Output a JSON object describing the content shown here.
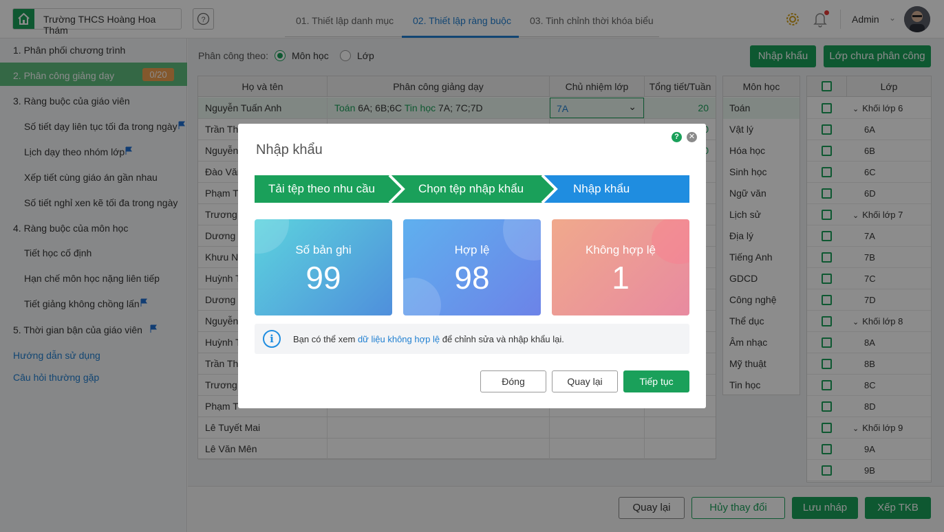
{
  "header": {
    "school_name": "Trường THCS Hoàng Hoa Thám",
    "tabs": [
      "01. Thiết lập danh mục",
      "02. Thiết lập ràng buộc",
      "03. Tinh chỉnh thời khóa biểu"
    ],
    "user": "Admin"
  },
  "sidebar": {
    "items": [
      "1. Phân phối chương trình",
      "2. Phân công giảng dạy",
      "3. Ràng buộc của giáo viên",
      "Số tiết dạy liên tục tối đa trong ngày",
      "Lịch dạy theo nhóm lớp",
      "Xếp tiết cùng giáo án gần nhau",
      "Số tiết nghỉ xen kẽ tối đa trong ngày",
      "4. Ràng buộc của môn học",
      "Tiết học cố định",
      "Hạn chế môn học nặng liên tiếp",
      "Tiết giảng không chồng lấn",
      "5. Thời gian bận của giáo viên"
    ],
    "badge": "0/20",
    "links": [
      "Hướng dẫn sử dụng",
      "Câu hỏi thường gặp"
    ]
  },
  "toolbar": {
    "assign_by_label": "Phân công theo:",
    "radio_subject": "Môn học",
    "radio_class": "Lớp",
    "import_button": "Nhập khẩu",
    "unassigned_button": "Lớp chưa phân công"
  },
  "table": {
    "headers": [
      "Họ và tên",
      "Phân công giảng dạy",
      "Chủ nhiệm lớp",
      "Tổng tiết/Tuần"
    ],
    "rows": [
      {
        "name": "Nguyễn Tuấn Anh",
        "subj1": "Toán",
        "classes1": "6A; 6B;6C",
        "subj2": "Tin học",
        "classes2": "7A; 7C;7D",
        "homeroom": "7A",
        "total": "20"
      },
      {
        "name": "Trần Tha",
        "total": "0"
      },
      {
        "name": "Nguyễn",
        "total": "0"
      },
      {
        "name": "Đào Văn"
      },
      {
        "name": "Phạm Th"
      },
      {
        "name": "Trương"
      },
      {
        "name": "Dương H"
      },
      {
        "name": "Khưu Ng"
      },
      {
        "name": "Huỳnh T"
      },
      {
        "name": "Dương T"
      },
      {
        "name": "Nguyễn"
      },
      {
        "name": "Huỳnh T"
      },
      {
        "name": "Trần Thị"
      },
      {
        "name": "Trương"
      },
      {
        "name": "Phạm T"
      },
      {
        "name": "Lê Tuyết Mai"
      },
      {
        "name": "Lê Văn Mên"
      }
    ]
  },
  "subjects": {
    "header": "Môn học",
    "items": [
      "Toán",
      "Vật lý",
      "Hóa học",
      "Sinh học",
      "Ngữ văn",
      "Lịch sử",
      "Địa lý",
      "Tiếng Anh",
      "GDCD",
      "Công nghệ",
      "Thể dục",
      "Âm nhạc",
      "Mỹ thuật",
      "Tin học"
    ]
  },
  "classes": {
    "header": "Lớp",
    "items": [
      "Khối lớp 6",
      "6A",
      "6B",
      "6C",
      "6D",
      "Khối lớp 7",
      "7A",
      "7B",
      "7C",
      "7D",
      "Khối lớp 8",
      "8A",
      "8B",
      "8C",
      "8D",
      "Khối lớp 9",
      "9A",
      "9B"
    ]
  },
  "footer": {
    "back": "Quay lại",
    "discard": "Hủy thay đổi",
    "save_draft": "Lưu nháp",
    "schedule": "Xếp TKB"
  },
  "modal": {
    "title": "Nhập khẩu",
    "steps": [
      "Tải tệp theo nhu cầu",
      "Chọn tệp nhập khẩu",
      "Nhập khẩu"
    ],
    "cards": [
      {
        "label": "Số bản ghi",
        "value": "99"
      },
      {
        "label": "Hợp lệ",
        "value": "98"
      },
      {
        "label": "Không hợp lệ",
        "value": "1"
      }
    ],
    "info_prefix": "Bạn có thể xem",
    "info_link": "dữ liệu không hợp lệ",
    "info_suffix": "để chỉnh sửa và nhập khẩu lại.",
    "buttons": {
      "close": "Đóng",
      "back": "Quay lại",
      "next": "Tiếp tục"
    }
  },
  "colors": {
    "accent": "#1aa05a",
    "link": "#1f7fd1",
    "step_active": "#1f8de0"
  }
}
